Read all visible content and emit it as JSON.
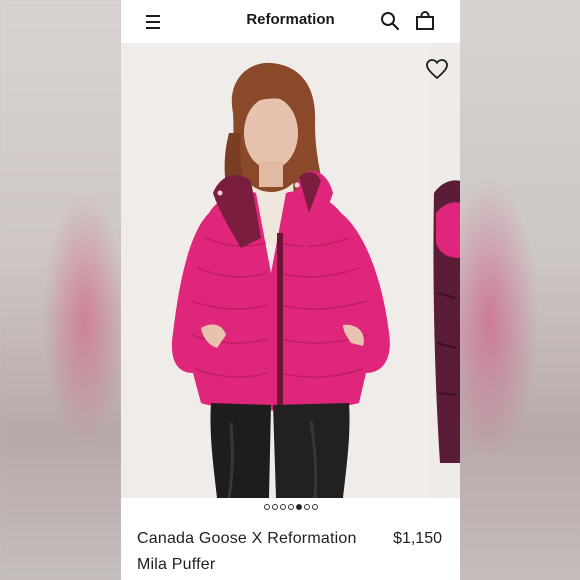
{
  "header": {
    "brand": "Reformation",
    "icons": [
      "menu-icon",
      "search-icon",
      "bag-icon"
    ]
  },
  "gallery": {
    "wishlist_icon": "heart-icon",
    "slide_count": 7,
    "active_slide": 5
  },
  "product": {
    "name": "Canada Goose X Reformation Mila Puffer",
    "price": "$1,150"
  },
  "colors": {
    "jacket": "#e0267a",
    "jacket_lining": "#7a1d3e",
    "pants": "#1e1c1c",
    "background": "#f1eeeb"
  }
}
